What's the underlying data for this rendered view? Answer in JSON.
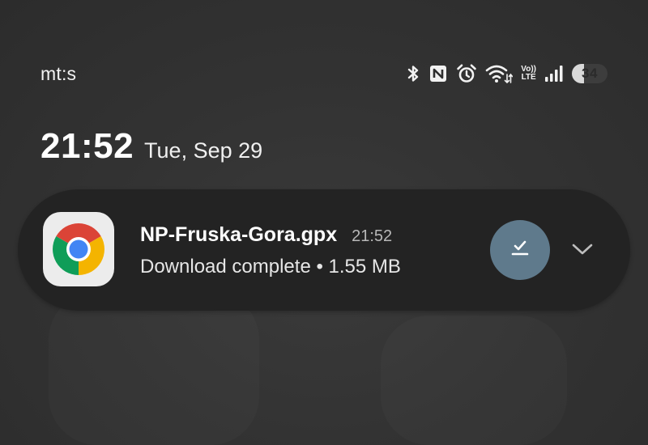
{
  "status_bar": {
    "carrier": "mt:s",
    "icons": [
      "bluetooth-icon",
      "nfc-icon",
      "alarm-icon",
      "wifi-icon",
      "volte-icon",
      "signal-icon",
      "battery-icon"
    ],
    "volte_top": "Vo))",
    "volte_bottom": "LTE",
    "battery_percent": 34,
    "battery_text": "34"
  },
  "clock": {
    "time": "21:52",
    "date": "Tue, Sep 29"
  },
  "notification": {
    "app_icon": "chrome-icon",
    "title": "NP-Fruska-Gora.gpx",
    "time": "21:52",
    "body": "Download complete • 1.55 MB",
    "action_icon": "download-done-icon",
    "expand_icon": "chevron-down-icon"
  },
  "colors": {
    "background": "#333333",
    "notification_bg": "#232323",
    "action_button": "#5f7a8c",
    "chrome_red": "#db4437",
    "chrome_yellow": "#f4b400",
    "chrome_green": "#0f9d58",
    "chrome_blue": "#4285f4"
  }
}
